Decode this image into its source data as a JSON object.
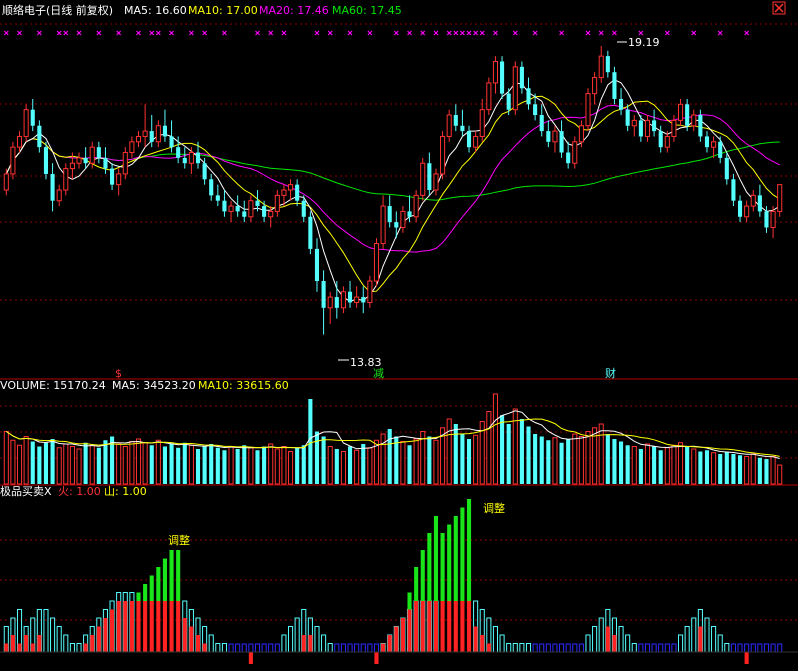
{
  "header": {
    "title": "顺络电子(日线 前复权)",
    "ma5_label": "MA5: 16.60",
    "ma10_label": "MA10: 17.00",
    "ma20_label": "MA20: 17.46",
    "ma60_label": "MA60: 17.45"
  },
  "volume_header": {
    "title": "VOLUME: 15170.24",
    "ma5_label": "MA5: 34523.20",
    "ma10_label": "MA10: 33615.60"
  },
  "indicator_header": {
    "title": "极品买卖X",
    "fire_label": "火: 1.00",
    "mountain_label": "山: 1.00"
  },
  "annotations": {
    "high_price": "19.19",
    "low_price": "13.83",
    "marker_s": "$",
    "marker_reduce": "减",
    "marker_finance": "财",
    "adjust_1": "调整",
    "adjust_2": "调整"
  },
  "colors": {
    "up": "#ff3232",
    "down": "#54ffff",
    "ma5": "#ffffff",
    "ma10": "#ffff00",
    "ma20": "#ff00ff",
    "ma60": "#00e600",
    "grid": "#8b0000",
    "green_bar": "#19e619",
    "red_bar": "#ff2222",
    "cyan_bar": "#54ffff",
    "blue_bar": "#2a2aff"
  },
  "chart_data": {
    "type": "candlestick",
    "price_range": [
      13.83,
      19.19
    ],
    "candles": [
      [
        16.5,
        16.9,
        16.4,
        16.8
      ],
      [
        16.8,
        17.4,
        16.7,
        17.3
      ],
      [
        17.3,
        17.6,
        17.2,
        17.5
      ],
      [
        17.5,
        18.1,
        17.4,
        18.0
      ],
      [
        18.0,
        18.2,
        17.6,
        17.7
      ],
      [
        17.7,
        17.8,
        17.2,
        17.3
      ],
      [
        17.3,
        17.4,
        16.7,
        16.8
      ],
      [
        16.8,
        17.0,
        16.1,
        16.3
      ],
      [
        16.3,
        16.6,
        16.2,
        16.5
      ],
      [
        16.5,
        17.0,
        16.4,
        16.9
      ],
      [
        16.9,
        17.2,
        16.7,
        17.0
      ],
      [
        17.0,
        17.2,
        16.9,
        17.1
      ],
      [
        17.1,
        17.3,
        16.9,
        17.0
      ],
      [
        17.0,
        17.4,
        16.9,
        17.3
      ],
      [
        17.3,
        17.4,
        17.0,
        17.1
      ],
      [
        17.1,
        17.3,
        16.8,
        16.9
      ],
      [
        16.9,
        17.0,
        16.5,
        16.6
      ],
      [
        16.6,
        16.9,
        16.4,
        16.8
      ],
      [
        16.8,
        17.3,
        16.7,
        17.2
      ],
      [
        17.2,
        17.5,
        17.1,
        17.4
      ],
      [
        17.4,
        17.6,
        17.3,
        17.5
      ],
      [
        17.5,
        18.1,
        17.3,
        17.6
      ],
      [
        17.6,
        17.9,
        17.3,
        17.4
      ],
      [
        17.4,
        17.8,
        17.3,
        17.7
      ],
      [
        17.7,
        18.0,
        17.4,
        17.5
      ],
      [
        17.5,
        17.8,
        17.2,
        17.3
      ],
      [
        17.3,
        17.5,
        17.0,
        17.1
      ],
      [
        17.1,
        17.3,
        16.9,
        17.0
      ],
      [
        17.0,
        17.3,
        16.8,
        17.2
      ],
      [
        17.2,
        17.4,
        16.9,
        17.0
      ],
      [
        17.0,
        17.1,
        16.6,
        16.7
      ],
      [
        16.7,
        16.8,
        16.3,
        16.4
      ],
      [
        16.4,
        16.6,
        16.2,
        16.3
      ],
      [
        16.3,
        16.5,
        16.0,
        16.1
      ],
      [
        16.1,
        16.3,
        15.9,
        16.2
      ],
      [
        16.2,
        16.4,
        16.0,
        16.1
      ],
      [
        16.1,
        16.3,
        15.9,
        16.0
      ],
      [
        16.0,
        16.4,
        15.9,
        16.3
      ],
      [
        16.3,
        16.5,
        16.1,
        16.2
      ],
      [
        16.2,
        16.3,
        15.9,
        16.0
      ],
      [
        16.0,
        16.2,
        15.8,
        16.1
      ],
      [
        16.1,
        16.5,
        16.0,
        16.4
      ],
      [
        16.4,
        16.6,
        16.2,
        16.5
      ],
      [
        16.5,
        16.7,
        16.3,
        16.6
      ],
      [
        16.6,
        16.7,
        16.2,
        16.3
      ],
      [
        16.3,
        16.4,
        15.9,
        16.0
      ],
      [
        16.0,
        16.1,
        15.3,
        15.4
      ],
      [
        15.4,
        15.6,
        14.6,
        14.8
      ],
      [
        14.8,
        15.0,
        13.8,
        14.3
      ],
      [
        14.3,
        14.6,
        14.0,
        14.5
      ],
      [
        14.5,
        14.8,
        14.1,
        14.3
      ],
      [
        14.3,
        14.7,
        14.2,
        14.6
      ],
      [
        14.6,
        14.8,
        14.3,
        14.4
      ],
      [
        14.4,
        14.7,
        14.3,
        14.5
      ],
      [
        14.5,
        14.7,
        14.2,
        14.4
      ],
      [
        14.4,
        14.9,
        14.3,
        14.8
      ],
      [
        14.8,
        15.6,
        14.7,
        15.5
      ],
      [
        15.5,
        16.4,
        15.4,
        16.2
      ],
      [
        16.2,
        16.4,
        15.8,
        15.9
      ],
      [
        15.9,
        16.1,
        15.6,
        15.8
      ],
      [
        15.8,
        16.2,
        15.7,
        16.1
      ],
      [
        16.1,
        16.4,
        15.9,
        16.0
      ],
      [
        16.0,
        16.5,
        15.9,
        16.4
      ],
      [
        16.4,
        17.1,
        16.3,
        17.0
      ],
      [
        17.0,
        17.2,
        16.4,
        16.5
      ],
      [
        16.5,
        16.9,
        16.4,
        16.8
      ],
      [
        16.8,
        17.6,
        16.7,
        17.5
      ],
      [
        17.5,
        18.0,
        17.4,
        17.9
      ],
      [
        17.9,
        18.1,
        17.6,
        17.7
      ],
      [
        17.7,
        18.0,
        17.5,
        17.6
      ],
      [
        17.6,
        17.7,
        17.2,
        17.3
      ],
      [
        17.3,
        17.6,
        17.2,
        17.5
      ],
      [
        17.5,
        18.2,
        17.4,
        18.0
      ],
      [
        18.0,
        18.6,
        17.9,
        18.5
      ],
      [
        18.5,
        19.0,
        18.3,
        18.9
      ],
      [
        18.9,
        19.0,
        18.2,
        18.3
      ],
      [
        18.3,
        18.4,
        17.9,
        18.0
      ],
      [
        18.0,
        18.9,
        17.9,
        18.8
      ],
      [
        18.8,
        18.9,
        18.3,
        18.4
      ],
      [
        18.4,
        18.6,
        18.0,
        18.1
      ],
      [
        18.1,
        18.3,
        17.8,
        17.9
      ],
      [
        17.9,
        18.1,
        17.5,
        17.6
      ],
      [
        17.6,
        17.8,
        17.3,
        17.4
      ],
      [
        17.4,
        17.7,
        17.2,
        17.6
      ],
      [
        17.6,
        17.8,
        17.1,
        17.2
      ],
      [
        17.2,
        17.4,
        16.9,
        17.0
      ],
      [
        17.0,
        17.5,
        16.9,
        17.4
      ],
      [
        17.4,
        17.8,
        17.3,
        17.7
      ],
      [
        17.7,
        18.4,
        17.6,
        18.3
      ],
      [
        18.3,
        18.7,
        18.1,
        18.6
      ],
      [
        18.6,
        19.19,
        18.5,
        19.0
      ],
      [
        19.0,
        19.1,
        18.6,
        18.7
      ],
      [
        18.7,
        18.8,
        18.1,
        18.2
      ],
      [
        18.2,
        18.4,
        17.9,
        18.0
      ],
      [
        18.0,
        18.1,
        17.6,
        17.7
      ],
      [
        17.7,
        17.9,
        17.5,
        17.8
      ],
      [
        17.8,
        17.9,
        17.4,
        17.5
      ],
      [
        17.5,
        17.9,
        17.4,
        17.8
      ],
      [
        17.8,
        18.0,
        17.5,
        17.6
      ],
      [
        17.6,
        17.7,
        17.2,
        17.3
      ],
      [
        17.3,
        17.6,
        17.2,
        17.5
      ],
      [
        17.5,
        17.9,
        17.4,
        17.8
      ],
      [
        17.8,
        18.2,
        17.7,
        18.1
      ],
      [
        18.1,
        18.2,
        17.6,
        17.7
      ],
      [
        17.7,
        18.0,
        17.6,
        17.9
      ],
      [
        17.9,
        18.0,
        17.4,
        17.5
      ],
      [
        17.5,
        17.6,
        17.2,
        17.3
      ],
      [
        17.3,
        17.5,
        17.1,
        17.4
      ],
      [
        17.4,
        17.5,
        17.0,
        17.1
      ],
      [
        17.1,
        17.2,
        16.6,
        16.7
      ],
      [
        16.7,
        16.8,
        16.2,
        16.3
      ],
      [
        16.3,
        16.4,
        15.9,
        16.0
      ],
      [
        16.0,
        16.3,
        15.9,
        16.2
      ],
      [
        16.2,
        16.5,
        16.1,
        16.4
      ],
      [
        16.4,
        16.6,
        16.0,
        16.1
      ],
      [
        16.1,
        16.2,
        15.7,
        15.8
      ],
      [
        15.8,
        16.2,
        15.6,
        16.1
      ],
      [
        16.1,
        16.5,
        16.0,
        16.6
      ]
    ],
    "volume": [
      42000,
      35000,
      31000,
      38000,
      34000,
      30000,
      33000,
      36000,
      29000,
      32000,
      30000,
      28000,
      33000,
      31000,
      29000,
      35000,
      38000,
      32000,
      30000,
      34000,
      36000,
      33000,
      31000,
      35000,
      30000,
      32000,
      29000,
      33000,
      31000,
      28000,
      30000,
      32000,
      29000,
      27000,
      30000,
      28000,
      31000,
      29000,
      27000,
      30000,
      32000,
      28000,
      30000,
      26000,
      29000,
      31000,
      68000,
      42000,
      38000,
      30000,
      28000,
      26000,
      30000,
      27000,
      32000,
      29000,
      35000,
      40000,
      44000,
      38000,
      34000,
      31000,
      36000,
      42000,
      38000,
      35000,
      45000,
      52000,
      48000,
      40000,
      36000,
      39000,
      50000,
      58000,
      72000,
      55000,
      48000,
      60000,
      52000,
      46000,
      40000,
      38000,
      35000,
      37000,
      33000,
      36000,
      40000,
      38000,
      42000,
      45000,
      48000,
      40000,
      36000,
      34000,
      31000,
      30000,
      28000,
      32000,
      30000,
      27000,
      29000,
      31000,
      33000,
      30000,
      28000,
      26000,
      27000,
      25000,
      24000,
      26000,
      24000,
      23000,
      22000,
      24000,
      21000,
      20000,
      22000,
      15170
    ],
    "volume_max": 72000,
    "ma5": [],
    "ma10": [],
    "ma20": [],
    "ma60": []
  }
}
